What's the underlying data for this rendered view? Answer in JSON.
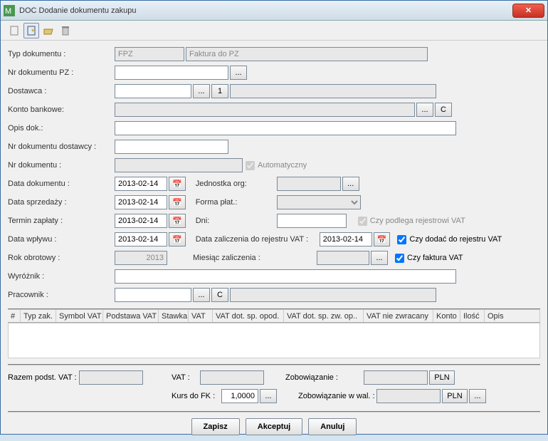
{
  "window": {
    "title": "DOC Dodanie dokumentu zakupu"
  },
  "labels": {
    "typDok": "Typ dokumentu :",
    "nrPZ": "Nr dokumentu PZ :",
    "dostawca": "Dostawca :",
    "konto": "Konto bankowe:",
    "opis": "Opis dok.:",
    "nrDost": "Nr dokumentu dostawcy :",
    "nrDok": "Nr dokumentu :",
    "auto": "Automatyczny",
    "dataDok": "Data dokumentu :",
    "dataSprz": "Data sprzedaży :",
    "termin": "Termin zapłaty :",
    "dataWpl": "Data wpływu :",
    "rok": "Rok obrotowy :",
    "wyroz": "Wyróżnik :",
    "prac": "Pracownik :",
    "jedn": "Jednostka org:",
    "forma": "Forma płat.:",
    "dni": "Dni:",
    "dataZal": "Data zaliczenia do rejestru VAT :",
    "miesZal": "Miesiąc zaliczenia :",
    "czyPodl": "Czy podlega rejestrowi VAT",
    "czyDod": "Czy dodać do rejestru VAT",
    "czyFakt": "Czy faktura VAT"
  },
  "values": {
    "typCode": "FPZ",
    "typDesc": "Faktura do PZ",
    "date": "2013-02-14",
    "rok": "2013",
    "kurs": "1,0000",
    "pln": "PLN",
    "one": "1",
    "dots": "...",
    "C": "C"
  },
  "sums": {
    "razem": "Razem podst. VAT :",
    "vat": "VAT :",
    "kurs": "Kurs do FK :",
    "zobow": "Zobowiązanie :",
    "zobowWal": "Zobowiązanie w wal. :"
  },
  "cols": {
    "n": "#",
    "typzak": "Typ zak.",
    "symvat": "Symbol VAT",
    "podst": "Podstawa VAT",
    "stawka": "Stawka",
    "vat": "VAT",
    "dotsp": "VAT dot. sp. opod.",
    "dotspzw": "VAT dot. sp. zw. op..",
    "niezw": "VAT nie zwracany",
    "konto": "Konto",
    "ilosc": "Ilość",
    "opis": "Opis"
  },
  "btns": {
    "zapisz": "Zapisz",
    "akcept": "Akceptuj",
    "anuluj": "Anuluj"
  }
}
